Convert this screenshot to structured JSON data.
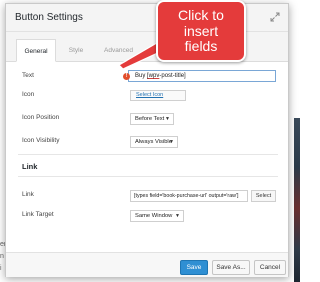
{
  "background": {
    "text_lines": [
      "ers",
      "n",
      "i"
    ]
  },
  "dialog": {
    "title": "Button Settings",
    "expand_icon": "expand-icon"
  },
  "tabs": [
    {
      "label": "General",
      "active": true
    },
    {
      "label": "Style",
      "active": false
    },
    {
      "label": "Advanced",
      "active": false
    }
  ],
  "fields": {
    "text": {
      "label": "Text",
      "value_prefix": "Buy ",
      "value_underlined": "[wpv",
      "value_suffix": "-post-title]",
      "badge": "!"
    },
    "icon": {
      "label": "Icon",
      "button": "Select Icon"
    },
    "icon_position": {
      "label": "Icon Position",
      "value": "Before Text"
    },
    "icon_visibility": {
      "label": "Icon Visibility",
      "value": "Always Visible"
    }
  },
  "link_section": {
    "title": "Link",
    "link": {
      "label": "Link",
      "value": "[types field='book-purchase-url' output='raw']",
      "button": "Select"
    },
    "link_target": {
      "label": "Link Target",
      "value": "Same Window"
    }
  },
  "footer": {
    "save": "Save",
    "save_as": "Save As...",
    "cancel": "Cancel"
  },
  "callout": {
    "text": "Click to\ninsert\nfields",
    "color": "#e43b3b"
  },
  "colors": {
    "primary_button": "#2f8fd3",
    "link": "#2271b1"
  }
}
